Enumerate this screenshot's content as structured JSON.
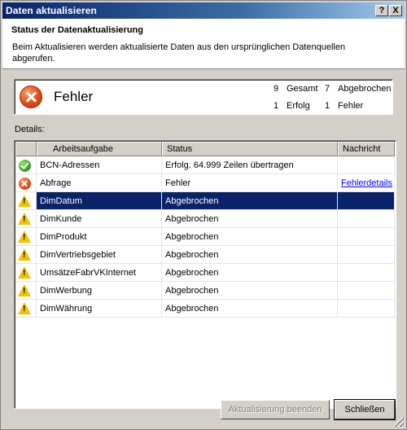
{
  "window": {
    "title": "Daten aktualisieren",
    "help_button": "?",
    "close_button": "X"
  },
  "header": {
    "title": "Status der Datenaktualisierung",
    "description": "Beim Aktualisieren werden aktualisierte Daten aus den ursprünglichen Datenquellen abgerufen."
  },
  "summary": {
    "status_label": "Fehler",
    "total_count": "9",
    "total_label": "Gesamt",
    "cancelled_count": "7",
    "cancelled_label": "Abgebrochen",
    "success_count": "1",
    "success_label": "Erfolg",
    "error_count": "1",
    "error_label": "Fehler"
  },
  "details": {
    "label": "Details:",
    "columns": [
      "",
      "Arbeitsaufgabe",
      "Status",
      "Nachricht"
    ],
    "rows": [
      {
        "icon": "success-icon",
        "task": "BCN-Adressen",
        "status": "Erfolg. 64.999 Zeilen übertragen",
        "message": ""
      },
      {
        "icon": "error-icon",
        "task": "Abfrage",
        "status": "Fehler",
        "message": "Fehlerdetails"
      },
      {
        "icon": "warning-icon",
        "task": "DimDatum",
        "status": "Abgebrochen",
        "message": ""
      },
      {
        "icon": "warning-icon",
        "task": "DimKunde",
        "status": "Abgebrochen",
        "message": ""
      },
      {
        "icon": "warning-icon",
        "task": "DimProdukt",
        "status": "Abgebrochen",
        "message": ""
      },
      {
        "icon": "warning-icon",
        "task": "DimVertriebsgebiet",
        "status": "Abgebrochen",
        "message": ""
      },
      {
        "icon": "warning-icon",
        "task": "UmsätzeFabrVKInternet",
        "status": "Abgebrochen",
        "message": ""
      },
      {
        "icon": "warning-icon",
        "task": "DimWerbung",
        "status": "Abgebrochen",
        "message": ""
      },
      {
        "icon": "warning-icon",
        "task": "DimWährung",
        "status": "Abgebrochen",
        "message": ""
      }
    ],
    "selected_row": "DimDatum"
  },
  "buttons": {
    "stop_label": "Aktualisierung beenden",
    "close_label": "Schließen"
  },
  "colors": {
    "selection": "#0a246a",
    "link": "#0000ff",
    "dialog_bg": "#d4d0c8"
  }
}
